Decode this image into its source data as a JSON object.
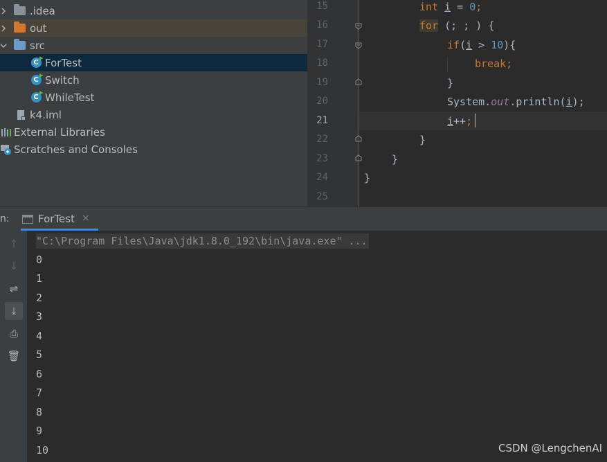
{
  "project": {
    "items": [
      {
        "label": ".idea",
        "icon": "folder-icon"
      },
      {
        "label": "out",
        "icon": "folder-icon"
      },
      {
        "label": "src",
        "icon": "folder-icon"
      },
      {
        "label": "ForTest",
        "icon": "java-class-icon"
      },
      {
        "label": "Switch",
        "icon": "java-class-icon"
      },
      {
        "label": "WhileTest",
        "icon": "java-class-icon"
      },
      {
        "label": "k4.iml",
        "icon": "iml-file-icon"
      },
      {
        "label": "External Libraries",
        "icon": "libraries-icon"
      },
      {
        "label": "Scratches and Consoles",
        "icon": "scratches-icon"
      }
    ],
    "selected": "ForTest"
  },
  "editor": {
    "line_numbers": [
      "15",
      "16",
      "17",
      "18",
      "19",
      "20",
      "21",
      "22",
      "23",
      "24",
      "25"
    ],
    "current_line": "21",
    "code": {
      "l15_kw": "int",
      "l15_var": "i",
      "l15_rest": " = ",
      "l15_num": "0",
      "l15_end": ";",
      "l16_kw": "for",
      "l16_rest": " (; ; ) {",
      "l17_kw": "if",
      "l17_open": "(",
      "l17_var": "i",
      "l17_op": " > ",
      "l17_num": "10",
      "l17_close": "){",
      "l18_kw": "break",
      "l18_end": ";",
      "l19": "}",
      "l20_cls": "System.",
      "l20_field": "out",
      "l20_call": ".println(",
      "l20_var": "i",
      "l20_end": ");",
      "l21_var": "i",
      "l21_op": "++",
      "l21_end": ";",
      "l22": "}",
      "l23": "}",
      "l24": "}"
    }
  },
  "run": {
    "prefix": "n:",
    "tab_label": "ForTest",
    "tab_close": "×"
  },
  "console": {
    "command": "\"C:\\Program Files\\Java\\jdk1.8.0_192\\bin\\java.exe\" ...",
    "output": [
      "0",
      "1",
      "2",
      "3",
      "4",
      "5",
      "6",
      "7",
      "8",
      "9",
      "10"
    ]
  },
  "toolbar": {
    "up": "↑",
    "down": "↓",
    "wrap": "⇌",
    "scroll_end": "⤓",
    "print": "⎙",
    "clear": "🗑"
  },
  "watermark": "CSDN @LengchenAI",
  "colors": {
    "keyword": "#cc7832",
    "number": "#6897bb",
    "field": "#9876aa",
    "class_icon": "#3592c4",
    "selection": "#0d293e"
  }
}
